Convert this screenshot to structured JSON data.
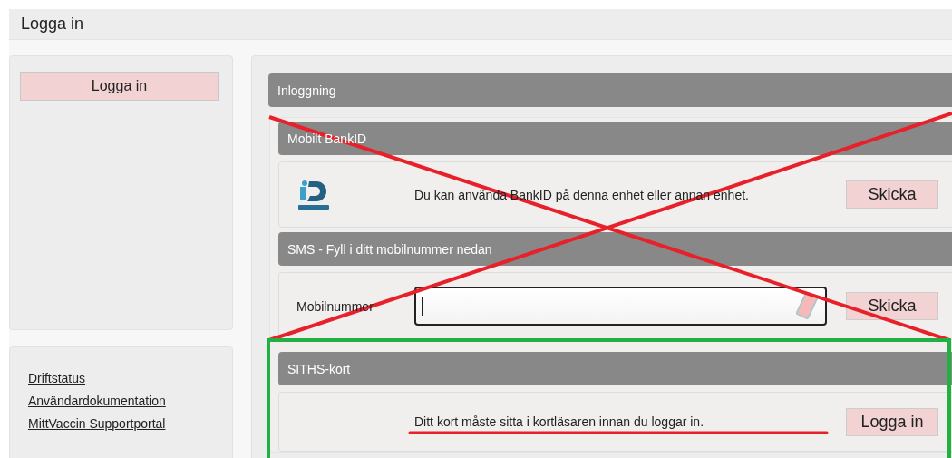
{
  "page_title": "Logga in",
  "sidebar": {
    "button": "Logga in",
    "links": [
      "Driftstatus",
      "Användardokumentation",
      "MittVaccin Supportportal"
    ]
  },
  "login": {
    "title": "Inloggning",
    "sections": [
      {
        "kind": "bankid",
        "title": "Mobilt BankID",
        "text": "Du kan använda BankID på denna enhet eller annan enhet.",
        "button": "Skicka"
      },
      {
        "kind": "sms",
        "title": "SMS - Fyll i ditt mobilnummer nedan",
        "field_label": "Mobilnummer",
        "button": "Skicka"
      },
      {
        "kind": "card",
        "title": "SITHS-kort",
        "text": "Ditt kort måste sitta i kortläsaren innan du loggar in.",
        "button": "Logga in"
      }
    ]
  },
  "annotations": [
    {
      "kind": "cross"
    },
    {
      "kind": "frame"
    },
    {
      "kind": "underline"
    }
  ]
}
